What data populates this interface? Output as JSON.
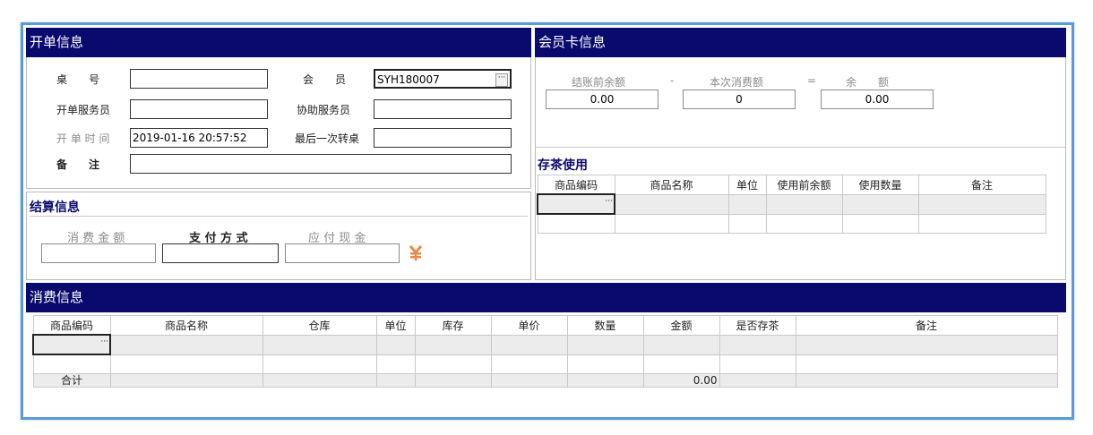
{
  "order": {
    "title": "开单信息",
    "table_no_label": "桌　　号",
    "table_no_value": "",
    "member_label": "会　　员",
    "member_value": "SYH180007",
    "open_staff_label": "开单服务员",
    "open_staff_value": "",
    "assist_staff_label": "协助服务员",
    "assist_staff_value": "",
    "open_time_label": "开 单 时 间",
    "open_time_value": "2019-01-16 20:57:52",
    "last_transfer_label": "最后一次转桌",
    "last_transfer_value": "",
    "remark_label": "备　　注",
    "remark_value": ""
  },
  "card": {
    "title": "会员卡信息",
    "before_label": "结账前余额",
    "minus": "-",
    "this_label": "本次消费额",
    "equals": "=",
    "rest_label": "余　　额",
    "before_value": "0.00",
    "this_value": "0",
    "rest_value": "0.00"
  },
  "tea": {
    "title": "存茶使用",
    "headers": [
      "商品编码",
      "商品名称",
      "单位",
      "使用前余额",
      "使用数量",
      "备注"
    ]
  },
  "settle": {
    "title": "结算信息",
    "amount_label": "消 费 金 额",
    "pay_label": "支 付 方 式",
    "cash_label": "应 付 现 金",
    "amount_value": "",
    "pay_value": "",
    "cash_value": ""
  },
  "consume": {
    "title": "消费信息",
    "headers": [
      "商品编码",
      "商品名称",
      "仓库",
      "单位",
      "库存",
      "单价",
      "数量",
      "金额",
      "是否存茶",
      "备注"
    ],
    "sum_label": "合计",
    "sum_amount": "0.00"
  },
  "colors": {
    "header_bar": "#0a0a6e",
    "frame_border": "#5b9bd5",
    "section_title": "#0a0a6e",
    "yen_icon": "#e8894a"
  },
  "icons": {
    "more": "ellipsis-icon",
    "pay": "yen-icon"
  }
}
